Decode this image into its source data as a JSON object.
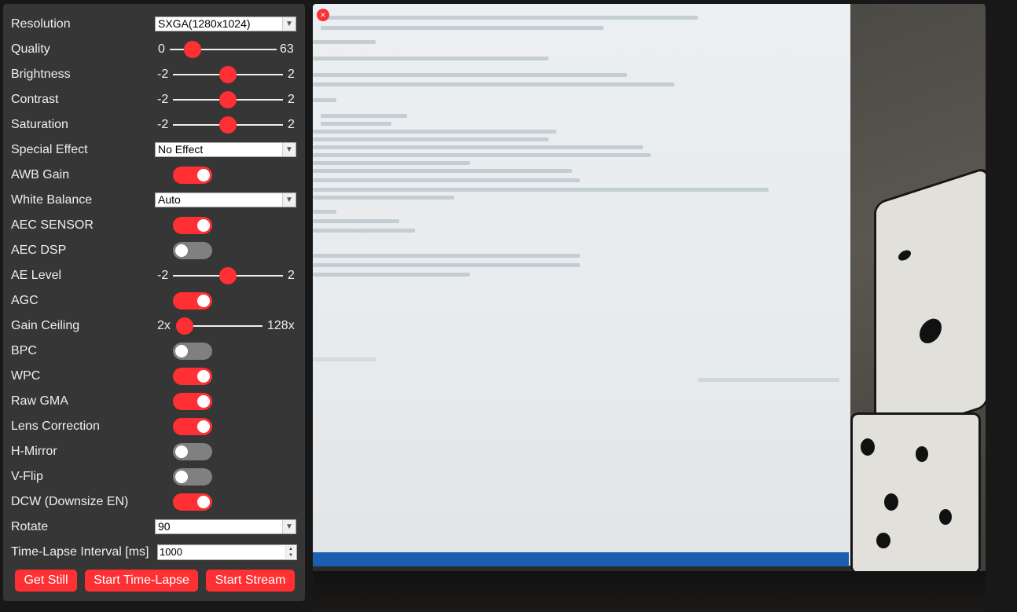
{
  "controls": {
    "resolution": {
      "label": "Resolution",
      "value": "SXGA(1280x1024)"
    },
    "quality": {
      "label": "Quality",
      "min": "0",
      "max": "63",
      "value": 10,
      "range": [
        0,
        63
      ]
    },
    "brightness": {
      "label": "Brightness",
      "min": "-2",
      "max": "2",
      "value": 0,
      "range": [
        -2,
        2
      ]
    },
    "contrast": {
      "label": "Contrast",
      "min": "-2",
      "max": "2",
      "value": 0,
      "range": [
        -2,
        2
      ]
    },
    "saturation": {
      "label": "Saturation",
      "min": "-2",
      "max": "2",
      "value": 0,
      "range": [
        -2,
        2
      ]
    },
    "special_effect": {
      "label": "Special Effect",
      "value": "No Effect"
    },
    "awb_gain": {
      "label": "AWB Gain",
      "on": true
    },
    "white_balance": {
      "label": "White Balance",
      "value": "Auto"
    },
    "aec_sensor": {
      "label": "AEC SENSOR",
      "on": true
    },
    "aec_dsp": {
      "label": "AEC DSP",
      "on": false
    },
    "ae_level": {
      "label": "AE Level",
      "min": "-2",
      "max": "2",
      "value": 0,
      "range": [
        -2,
        2
      ]
    },
    "agc": {
      "label": "AGC",
      "on": true
    },
    "gain_ceiling": {
      "label": "Gain Ceiling",
      "min": "2x",
      "max": "128x",
      "value": 0,
      "range": [
        0,
        6
      ]
    },
    "bpc": {
      "label": "BPC",
      "on": false
    },
    "wpc": {
      "label": "WPC",
      "on": true
    },
    "raw_gma": {
      "label": "Raw GMA",
      "on": true
    },
    "lens_correction": {
      "label": "Lens Correction",
      "on": true
    },
    "h_mirror": {
      "label": "H-Mirror",
      "on": false
    },
    "v_flip": {
      "label": "V-Flip",
      "on": false
    },
    "dcw": {
      "label": "DCW (Downsize EN)",
      "on": true
    },
    "rotate": {
      "label": "Rotate",
      "value": "90"
    },
    "timelapse_interval": {
      "label": "Time-Lapse Interval [ms]",
      "value": "1000"
    }
  },
  "buttons": {
    "get_still": "Get Still",
    "start_timelapse": "Start Time-Lapse",
    "start_stream": "Start Stream"
  },
  "viewer": {
    "close_glyph": "×"
  },
  "colors": {
    "accent": "#ff3034",
    "panel_bg": "#363636",
    "page_bg": "#181818",
    "toggle_off": "#808080"
  }
}
